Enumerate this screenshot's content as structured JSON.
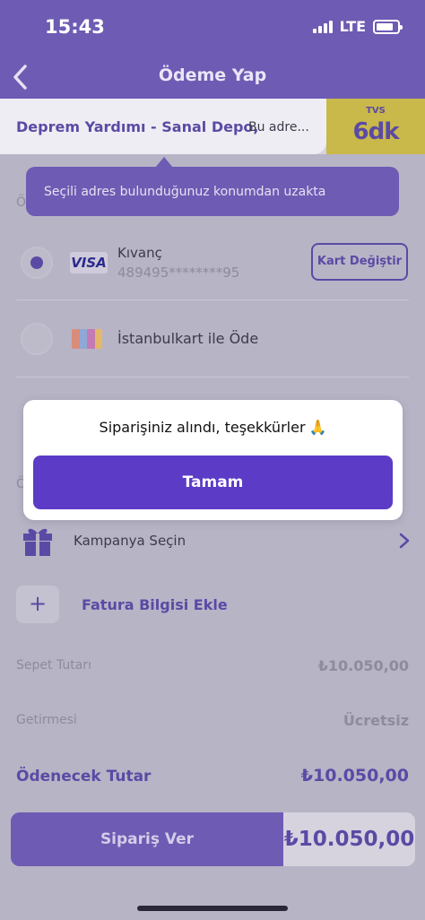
{
  "status_bar": {
    "time": "15:43",
    "network": "LTE"
  },
  "header": {
    "title": "Ödeme Yap"
  },
  "address": {
    "name": "Deprem Yardımı - Sanal Depo,",
    "detail": "Bu adre...",
    "eta_label": "TVS",
    "eta_value": "6dk"
  },
  "tooltip": {
    "text": "Seçili adres bulunduğunuz konumdan uzakta"
  },
  "payment": {
    "section_initial": "Ö",
    "card": {
      "brand": "VISA",
      "holder": "Kıvanç",
      "number": "489495********95",
      "change_button": "Kart Değiştir"
    },
    "istanbulkart": {
      "label": "İstanbulkart ile Öde"
    }
  },
  "modal": {
    "message": "Siparişiniz alındı, teşekkürler",
    "emoji": "🙏",
    "ok_button": "Tamam"
  },
  "extras": {
    "section_initial": "Ö",
    "campaign_label": "Kampanya Seçin",
    "invoice_label": "Fatura Bilgisi Ekle",
    "plus": "+"
  },
  "summary": {
    "subtotal_label": "Sepet Tutarı",
    "subtotal_value": "₺10.050,00",
    "delivery_label": "Getirmesi",
    "delivery_value": "Ücretsiz",
    "total_label": "Ödenecek Tutar",
    "total_value": "₺10.050,00"
  },
  "order": {
    "button": "Sipariş Ver",
    "amount": "₺10.050,00"
  },
  "colors": {
    "primary": "#5c3bc6",
    "header": "#6e5bb3",
    "eta": "#c9b84a"
  }
}
